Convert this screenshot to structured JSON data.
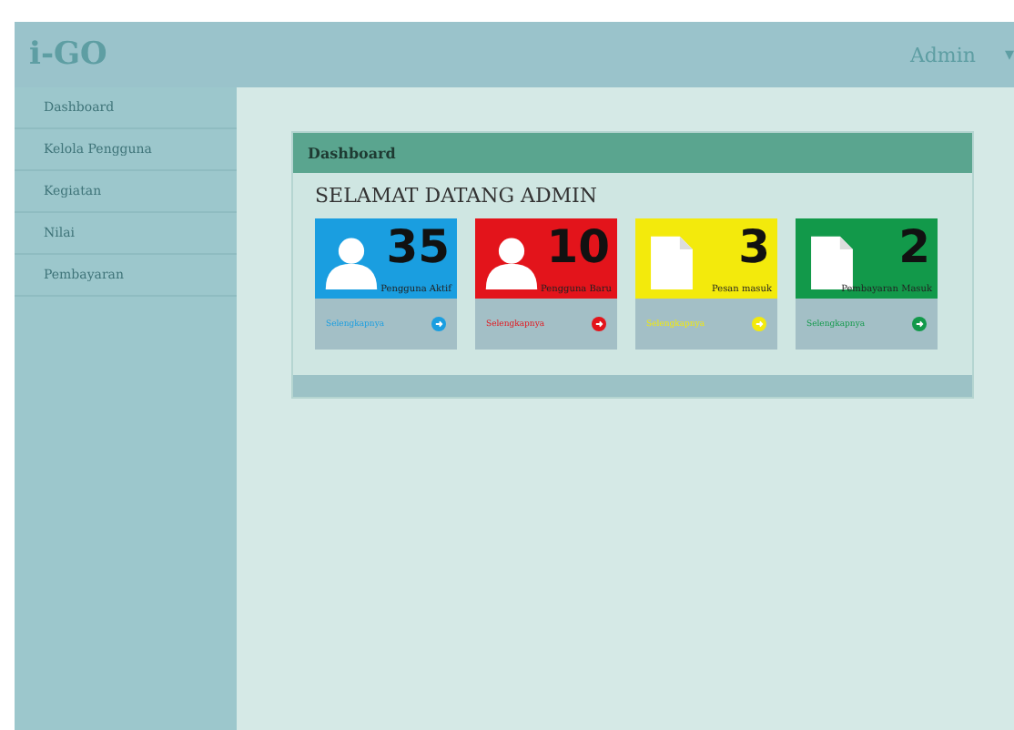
{
  "header": {
    "logo": "i-GO",
    "user": "Admin",
    "caret": "▾"
  },
  "sidebar": {
    "items": [
      {
        "label": "Dashboard"
      },
      {
        "label": "Kelola Pengguna"
      },
      {
        "label": "Kegiatan"
      },
      {
        "label": "Nilai"
      },
      {
        "label": "Pembayaran"
      }
    ]
  },
  "panel": {
    "title": "Dashboard",
    "welcome": "SELAMAT DATANG ADMIN",
    "cards": [
      {
        "kind": "user",
        "count": "35",
        "caption": "Pengguna Aktif",
        "link": "Selengkapnya",
        "color": "#1a9ee0"
      },
      {
        "kind": "user",
        "count": "10",
        "caption": "Pengguna Baru",
        "link": "Selengkapnya",
        "color": "#e3141b"
      },
      {
        "kind": "document",
        "count": "3",
        "caption": "Pesan masuk",
        "link": "Selengkapnya",
        "color": "#f3ea0c"
      },
      {
        "kind": "document",
        "count": "2",
        "caption": "Pembayaran Masuk",
        "link": "Selengkapnya",
        "color": "#12994a"
      }
    ]
  }
}
